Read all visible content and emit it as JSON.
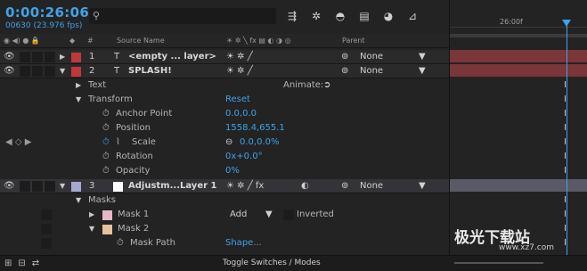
{
  "header": {
    "timecode": "0:00:26:06",
    "frames": "00630 (23.976 fps)",
    "search_placeholder": "",
    "search_icon": "search-icon"
  },
  "toolbar": {
    "icons": [
      "graph-editor-icon",
      "draft-3d-icon",
      "motion-blur-icon",
      "frame-blend-icon",
      "shy-icon",
      "comp-flowchart-icon"
    ]
  },
  "columns": {
    "source_name": "Source Name",
    "parent": "Parent"
  },
  "layers": [
    {
      "num": "1",
      "name": "<empty ... layer>",
      "color": "#c0383a",
      "parent": "None",
      "expanded": false
    },
    {
      "num": "2",
      "name": "SPLASH!",
      "color": "#c0383a",
      "parent": "None",
      "expanded": true,
      "text_icon": "T"
    },
    {
      "num": "3",
      "name": "Adjustm...Layer 1",
      "color": "#a7a8cf",
      "parent": "None",
      "expanded": true
    }
  ],
  "splash_props": {
    "text": "Text",
    "animate": "Animate:",
    "transform": "Transform",
    "reset": "Reset",
    "anchor_point": "Anchor Point",
    "anchor_point_val": "0.0,0.0",
    "position": "Position",
    "position_val": "1558.4,655.1",
    "scale": "Scale",
    "scale_val": "0.0,0.0%",
    "rotation": "Rotation",
    "rotation_val": "0x+0.0°",
    "opacity": "Opacity",
    "opacity_val": "0%"
  },
  "adj_props": {
    "masks": "Masks",
    "mask1": "Mask 1",
    "mask1_mode": "Add",
    "inverted": "Inverted",
    "mask2": "Mask 2",
    "mask_path": "Mask Path",
    "mask_path_val": "Shape..."
  },
  "timeline": {
    "ruler_label": "26:00f"
  },
  "footer": {
    "toggle_label": "Toggle Switches / Modes"
  },
  "watermark": {
    "text": "极光下载站",
    "url": "www.xz7.com"
  },
  "colors": {
    "accent": "#3ea3e8",
    "layer_red": "#c0383a",
    "layer_lavender": "#a7a8cf",
    "bar_red": "#7a3638",
    "bar_adj": "#5a5a66"
  }
}
